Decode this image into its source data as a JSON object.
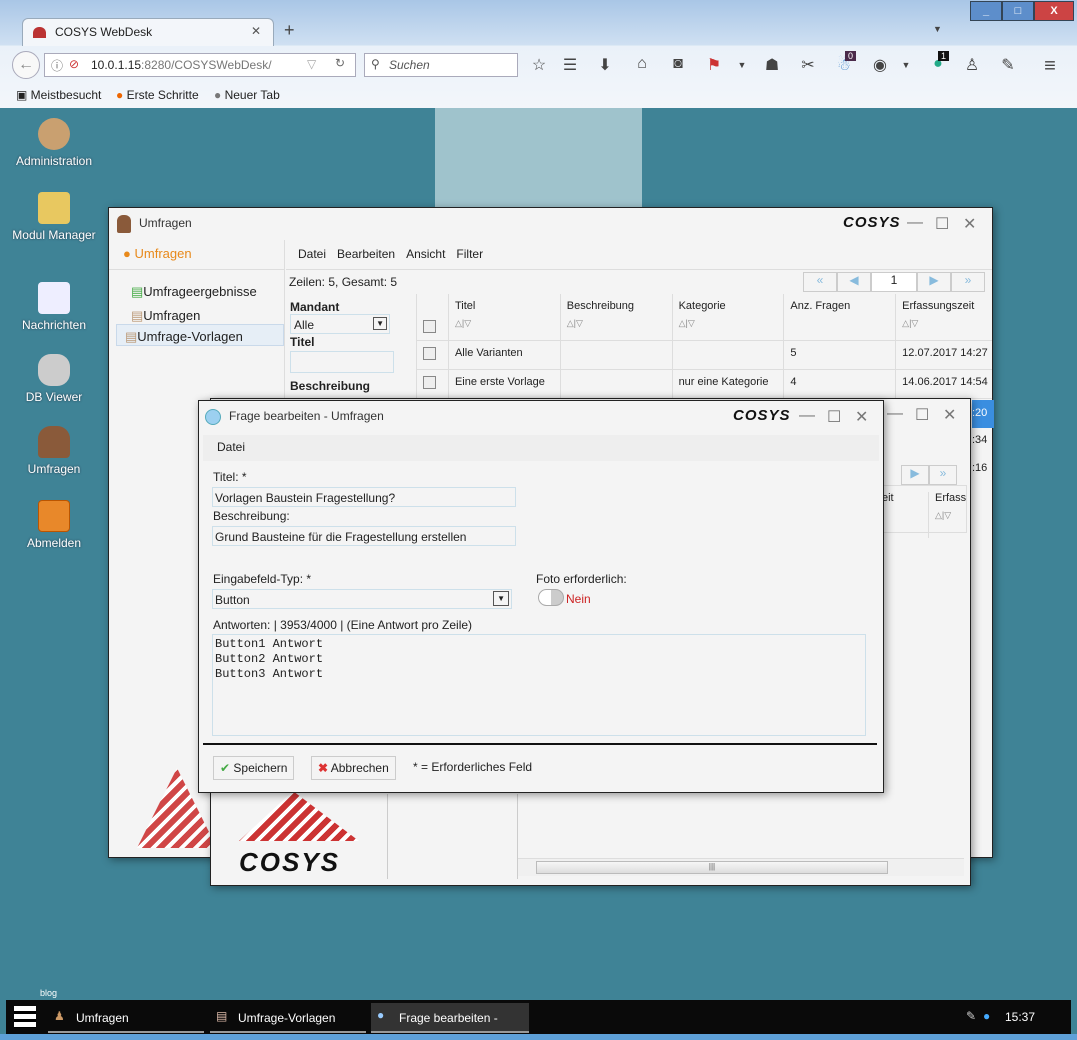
{
  "browser": {
    "tab_title": "COSYS WebDesk",
    "url_host": "10.0.1.15",
    "url_rest": ":8280/COSYSWebDesk/",
    "search_placeholder": "Suchen",
    "badge_a": "0",
    "badge_b": "1",
    "bookmarks": [
      "Meistbesucht",
      "Erste Schritte",
      "Neuer Tab"
    ]
  },
  "desktop": {
    "icons": [
      "Administration",
      "Modul Manager",
      "Nachrichten",
      "DB Viewer",
      "Umfragen",
      "Abmelden"
    ],
    "small_label": "blog"
  },
  "umfragen": {
    "title": "Umfragen",
    "nav_header": "Umfragen",
    "nav_items": [
      "Umfrageergebnisse",
      "Umfragen",
      "Umfrage-Vorlagen"
    ],
    "menu": [
      "Datei",
      "Bearbeiten",
      "Ansicht",
      "Filter"
    ],
    "row_count": "Zeilen: 5, Gesamt: 5",
    "page": "1",
    "filters": {
      "mandant_label": "Mandant",
      "mandant_value": "Alle",
      "titel_label": "Titel",
      "beschreibung_label": "Beschreibung"
    },
    "columns": [
      "Titel",
      "Beschreibung",
      "Kategorie",
      "Anz. Fragen",
      "Erfassungszeit"
    ],
    "rows": [
      [
        "Alle Varianten",
        "",
        "",
        "5",
        "12.07.2017 14:27"
      ],
      [
        "Eine erste Vorlage",
        "",
        "nur eine Kategorie",
        "4",
        "14.06.2017 14:54"
      ]
    ],
    "partial_times": [
      ":20",
      ":34",
      ":16"
    ]
  },
  "middle": {
    "col_a": "eit",
    "col_b": "Erfass"
  },
  "dialog": {
    "title": "Frage bearbeiten - Umfragen",
    "menu": "Datei",
    "titel_label": "Titel: *",
    "titel_value": "Vorlagen Baustein Fragestellung?",
    "beschreibung_label": "Beschreibung:",
    "beschreibung_value": "Grund Bausteine für die Fragestellung erstellen",
    "typ_label": "Eingabefeld-Typ: *",
    "typ_value": "Button",
    "foto_label": "Foto erforderlich:",
    "foto_value": "Nein",
    "antworten_label": "Antworten: | 3953/4000 | (Eine Antwort pro Zeile)",
    "antworten_value": "Button1 Antwort\nButton2 Antwort\nButton3 Antwort",
    "save": "Speichern",
    "cancel": "Abbrechen",
    "required_note": "* = Erforderliches Feld",
    "logo": "COSYS"
  },
  "taskbar": {
    "items": [
      "Umfragen",
      "Umfrage-Vorlagen",
      "Frage bearbeiten -"
    ],
    "clock": "15:37"
  }
}
